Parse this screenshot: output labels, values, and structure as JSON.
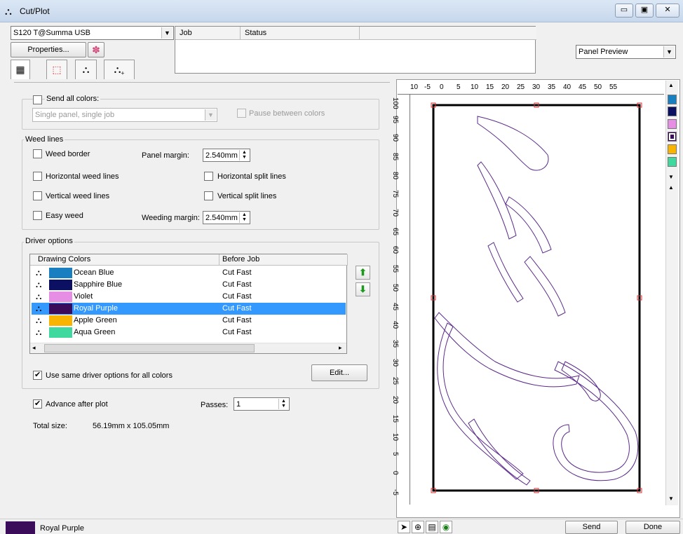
{
  "window": {
    "title": "Cut/Plot"
  },
  "toolbar": {
    "device_select": "S120 T@Summa USB",
    "properties_label": "Properties...",
    "preview_mode": "Panel Preview"
  },
  "job_table": {
    "columns": [
      "Job",
      "Status"
    ]
  },
  "send_all": {
    "label": "Send all colors:",
    "mode": "Single panel, single job",
    "pause_label": "Pause between colors"
  },
  "weed": {
    "group_label": "Weed lines",
    "weed_border": "Weed border",
    "panel_margin_label": "Panel margin:",
    "panel_margin_value": "2.540mm",
    "horizontal_weed": "Horizontal weed lines",
    "horizontal_split": "Horizontal split lines",
    "vertical_weed": "Vertical weed lines",
    "vertical_split": "Vertical split lines",
    "easy_weed": "Easy weed",
    "weeding_margin_label": "Weeding margin:",
    "weeding_margin_value": "2.540mm"
  },
  "driver": {
    "group_label": "Driver options",
    "col_colors": "Drawing Colors",
    "col_before": "Before Job",
    "rows": [
      {
        "name": "Ocean Blue",
        "color": "#1a7fc0",
        "before": "Cut Fast"
      },
      {
        "name": "Sapphire Blue",
        "color": "#0b1063",
        "before": "Cut Fast"
      },
      {
        "name": "Violet",
        "color": "#e58ee3",
        "before": "Cut Fast"
      },
      {
        "name": "Royal Purple",
        "color": "#3a0c5a",
        "before": "Cut Fast"
      },
      {
        "name": "Apple Green",
        "color": "#f8b400",
        "before": "Cut Fast"
      },
      {
        "name": "Aqua Green",
        "color": "#3fd9a0",
        "before": "Cut Fast"
      }
    ],
    "same_options_label": "Use same driver options for all colors",
    "edit_label": "Edit..."
  },
  "advance_label": "Advance after plot",
  "passes_label": "Passes:",
  "passes_value": "1",
  "total_size_label": "Total size:",
  "total_size_value": "56.19mm x 105.05mm",
  "ruler_top": [
    "10",
    "-5",
    "0",
    "5",
    "10",
    "15",
    "20",
    "25",
    "30",
    "35",
    "40",
    "45",
    "50",
    "55"
  ],
  "ruler_left": [
    "100",
    "95",
    "90",
    "85",
    "80",
    "75",
    "70",
    "65",
    "60",
    "55",
    "50",
    "45",
    "40",
    "35",
    "30",
    "25",
    "20",
    "15",
    "10",
    "5",
    "0",
    "-5"
  ],
  "preview_colors": [
    "#1a7fc0",
    "#0b1063",
    "#e58ee3",
    "#3a0c5a",
    "#f8b400",
    "#3fd9a0"
  ],
  "status": {
    "current_color": "Royal Purple",
    "current_color_hex": "#3a0c5a"
  },
  "footer": {
    "send_label": "Send",
    "done_label": "Done"
  }
}
